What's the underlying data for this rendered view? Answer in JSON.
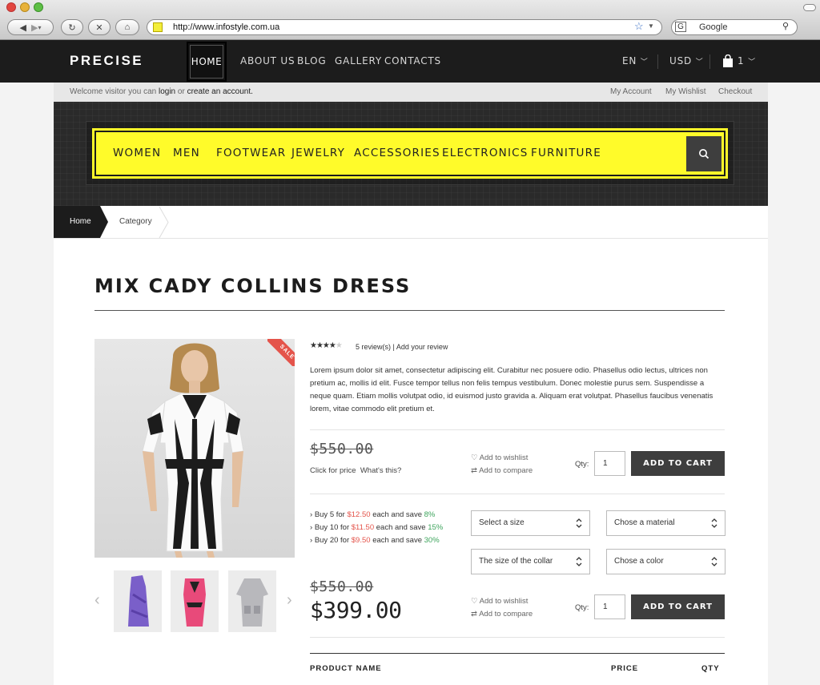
{
  "browser": {
    "url": "http://www.infostyle.com.ua",
    "search_placeholder": "Google"
  },
  "site": {
    "logo": "PRECISE",
    "nav": [
      "HOME",
      "ABOUT US",
      "BLOG",
      "GALLERY",
      "CONTACTS"
    ],
    "language": "EN",
    "currency": "USD",
    "cart_count": "1",
    "welcome": {
      "prefix": "Welcome visitor you can",
      "login": "login",
      "or": "or",
      "create": "create an account."
    },
    "account_links": [
      "My Account",
      "My Wishlist",
      "Checkout"
    ],
    "categories": [
      "WOMEN",
      "MEN",
      "FOOTWEAR",
      "JEWELRY",
      "ACCESSORIES",
      "ELECTRONICS",
      "FURNITURE"
    ],
    "accent_color": "#fffb2a"
  },
  "breadcrumb": [
    "Home",
    "Category"
  ],
  "product": {
    "title": "MIX CADY COLLINS DRESS",
    "badge": "SALE",
    "rating": 4,
    "rating_max": 5,
    "reviews": "5 review(s)",
    "add_review": "| Add your review",
    "description": "Lorem ipsum dolor sit amet, consectetur adipiscing elit. Curabitur nec posuere odio. Phasellus odio lectus, ultrices non pretium ac, mollis id elit. Fusce tempor tellus non felis tempus vestibulum. Donec molestie purus sem. Suspendisse a neque quam. Etiam mollis volutpat odio, id euismod justo gravida a. Aliquam erat volutpat. Phasellus faucibus venenatis lorem, vitae commodo elit pretium et.",
    "block1": {
      "old_price": "$550.00",
      "click_for_price": "Click for price",
      "whats_this": "What's this?",
      "wishlist": "Add to wishlist",
      "compare": "Add to compare",
      "qty_label": "Qty:",
      "qty": "1",
      "cart": "ADD TO CART"
    },
    "tiers": [
      {
        "prefix": "Buy 5 for",
        "price": "$12.50",
        "mid": "each and save",
        "save": "8%"
      },
      {
        "prefix": "Buy 10 for",
        "price": "$11.50",
        "mid": "each and save",
        "save": "15%"
      },
      {
        "prefix": "Buy 20 for",
        "price": "$9.50",
        "mid": "each and save",
        "save": "30%"
      }
    ],
    "selects": [
      "Select a size",
      "Chose a material",
      "The size of the collar",
      "Chose a color"
    ],
    "block2": {
      "old_price": "$550.00",
      "new_price": "$399.00",
      "wishlist": "Add to wishlist",
      "compare": "Add to compare",
      "qty_label": "Qty:",
      "qty": "1",
      "cart": "ADD TO CART"
    },
    "table_headers": [
      "PRODUCT NAME",
      "PRICE",
      "QTY"
    ]
  }
}
